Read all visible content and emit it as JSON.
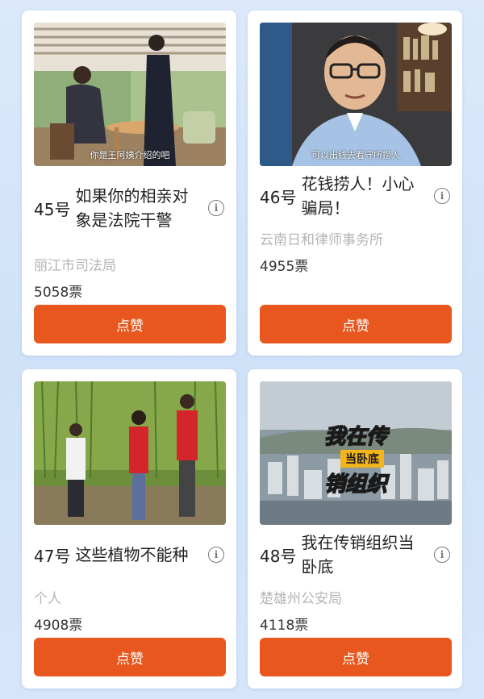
{
  "cards": [
    {
      "number": "45号",
      "title": "如果你的相亲对象是法院干警",
      "org": "丽江市司法局",
      "votes": "5058票",
      "like_label": "点赞",
      "thumb_caption": "你是王阿姨介绍的吧",
      "icon": "info-icon"
    },
    {
      "number": "46号",
      "title": "花钱捞人！小心骗局！",
      "org": "云南日和律师事务所",
      "votes": "4955票",
      "like_label": "点赞",
      "thumb_caption": "可以出钱去看守所捞人",
      "icon": "info-icon"
    },
    {
      "number": "47号",
      "title": "这些植物不能种",
      "org": "个人",
      "votes": "4908票",
      "like_label": "点赞",
      "icon": "info-icon"
    },
    {
      "number": "48号",
      "title": "我在传销组织当卧底",
      "org": "楚雄州公安局",
      "votes": "4118票",
      "like_label": "点赞",
      "thumb_overlay_1": "我在传",
      "thumb_overlay_2": "当卧底",
      "thumb_overlay_3": "销组织",
      "icon": "info-icon"
    }
  ],
  "colors": {
    "accent": "#e8581e",
    "card_bg": "#ffffff",
    "page_bg": "#d3e4f9"
  }
}
